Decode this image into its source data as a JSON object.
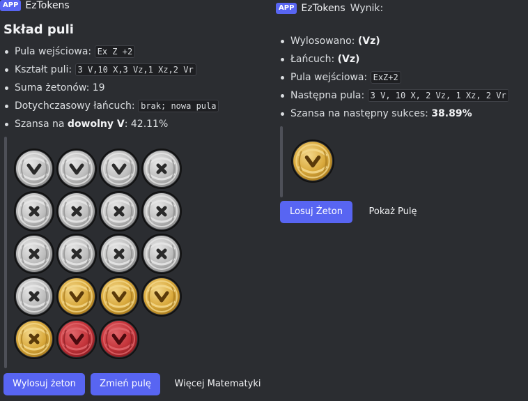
{
  "left": {
    "app_badge": "APP",
    "bot_name": "EzTokens",
    "title": "Skład puli",
    "items": [
      {
        "label": "Pula wejściowa: ",
        "code": "Ex Z +2"
      },
      {
        "label": "Kształt puli: ",
        "code": "3 V,10 X,3 Vz,1 Xz,2 Vr"
      },
      {
        "label": "Suma żetonów: 19"
      },
      {
        "label": "Dotychczasowy łańcuch: ",
        "code": "brak; nowa pula"
      },
      {
        "label": "Szansa na ",
        "bold": "dowolny V",
        "after": ": 42.11%"
      }
    ],
    "tokens": [
      "silver-V",
      "silver-V",
      "silver-V",
      "silver-X",
      "silver-X",
      "silver-X",
      "silver-X",
      "silver-X",
      "silver-X",
      "silver-X",
      "silver-X",
      "silver-X",
      "silver-X",
      "gold-V",
      "gold-V",
      "gold-V",
      "gold-X",
      "red-V",
      "red-V"
    ],
    "buttons": {
      "draw": "Wylosuj żeton",
      "change": "Zmień pulę",
      "more": "Więcej Matematyki"
    }
  },
  "right": {
    "app_badge": "APP",
    "bot_name": "EzTokens",
    "header_after": "Wynik:",
    "items": [
      {
        "label": "Wylosowano: ",
        "bold": "(Vz)"
      },
      {
        "label": "Łańcuch: ",
        "bold": "(Vz)"
      },
      {
        "label": "Pula wejściowa: ",
        "code": "ExZ+2"
      },
      {
        "label": "Następna pula: ",
        "code": "3 V, 10 X, 2 Vz, 1 Xz, 2 Vr"
      },
      {
        "label": "Szansa na następny sukces: ",
        "bold": "38.89%"
      }
    ],
    "drawn_token": "gold-V",
    "buttons": {
      "draw": "Losuj Żeton",
      "show": "Pokaż Pulę"
    }
  },
  "colors": {
    "background": "#2b2d31",
    "blurple": "#5865f2",
    "silver": "#c8c8c8",
    "gold": "#e0b84a",
    "red": "#c4343a"
  }
}
